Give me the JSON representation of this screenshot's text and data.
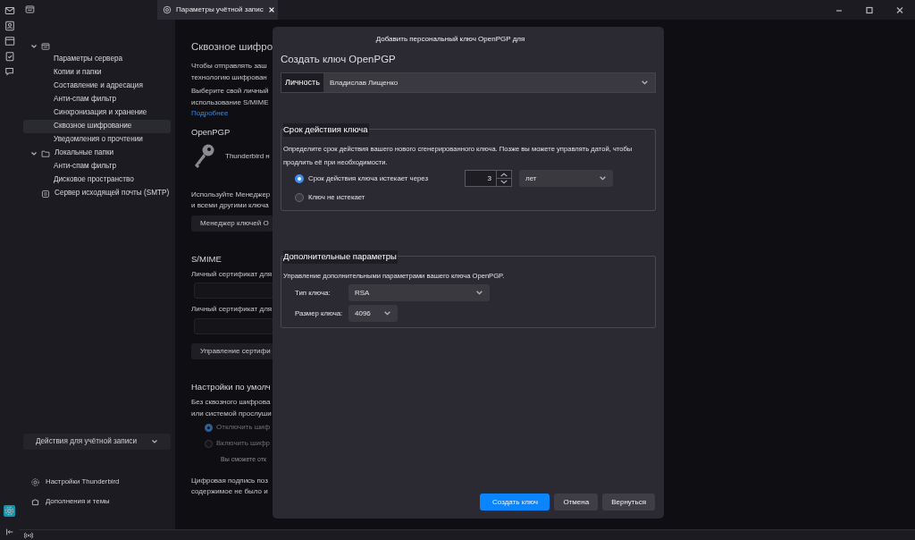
{
  "window": {
    "tab_title": "Параметры учётной запис"
  },
  "spaces": [
    {
      "kind": "mail",
      "selected": false
    },
    {
      "kind": "contacts",
      "selected": false
    },
    {
      "kind": "calendar",
      "selected": false
    },
    {
      "kind": "tasks",
      "selected": false
    },
    {
      "kind": "chat",
      "selected": false
    }
  ],
  "sidebar": {
    "tree": [
      {
        "kind": "account",
        "expanded": true,
        "selected": false,
        "children": [
          {
            "label": "Параметры сервера",
            "selected": false
          },
          {
            "label": "Копии и папки",
            "selected": false
          },
          {
            "label": "Составление и адресация",
            "selected": false
          },
          {
            "label": "Анти-спам фильтр",
            "selected": false
          },
          {
            "label": "Синхронизация и хранение",
            "selected": false
          },
          {
            "label": "Сквозное шифрование",
            "selected": true
          },
          {
            "label": "Уведомления о прочтении",
            "selected": false
          }
        ]
      },
      {
        "kind": "folder",
        "label": "Локальные папки",
        "expanded": true,
        "selected": false,
        "children": [
          {
            "label": "Анти-спам фильтр",
            "selected": false
          },
          {
            "label": "Дисковое пространство",
            "selected": false
          }
        ]
      },
      {
        "kind": "server",
        "label": "Сервер исходящей почты (SMTP)",
        "selected": false
      }
    ],
    "actions_button": "Действия для учётной записи",
    "links": [
      {
        "kind": "settings",
        "label": "Настройки Thunderbird"
      },
      {
        "kind": "addons",
        "label": "Дополнения и темы"
      }
    ]
  },
  "content": [
    {
      "kind": "heading",
      "text": "Сквозное шифро"
    },
    {
      "kind": "text",
      "text": "Чтобы отправлять заш"
    },
    {
      "kind": "text",
      "text": "технологию шифрован"
    },
    {
      "kind": "gap"
    },
    {
      "kind": "text",
      "text": "Выберите свой личный"
    },
    {
      "kind": "text",
      "text": "использование S/MIME"
    },
    {
      "kind": "link",
      "text": "Подробнее"
    },
    {
      "kind": "subheading",
      "text": "OpenPGP"
    },
    {
      "kind": "keyline",
      "text": "Thunderbird н"
    },
    {
      "kind": "text",
      "text": "Используйте Менеджер"
    },
    {
      "kind": "text",
      "text": "и всеми другими ключа"
    },
    {
      "kind": "button",
      "text": "Менеджер ключей О"
    },
    {
      "kind": "subheading",
      "text": "S/MIME"
    },
    {
      "kind": "text",
      "text": "Личный сертификат для"
    },
    {
      "kind": "field"
    },
    {
      "kind": "text",
      "text": "Личный сертификат для"
    },
    {
      "kind": "field"
    },
    {
      "kind": "button",
      "text": "Управление сертифи"
    },
    {
      "kind": "subheading",
      "text": "Настройки по умолч"
    },
    {
      "kind": "text",
      "text": "Без сквозного шифрова"
    },
    {
      "kind": "text",
      "text": "или системой прослуши"
    },
    {
      "kind": "radio",
      "text": "Отключить шиф",
      "selected": true
    },
    {
      "kind": "radio",
      "text": "Включить шифр",
      "selected": false
    },
    {
      "kind": "note",
      "text": "Вы сможете отк"
    },
    {
      "kind": "text",
      "text": "Цифровая подпись поз"
    },
    {
      "kind": "text",
      "text": "содержимое не было и"
    }
  ],
  "dialog": {
    "title": "Добавить персональный ключ OpenPGP для",
    "heading": "Создать ключ OpenPGP",
    "identity": {
      "label": "Личность",
      "value": "Владислав Лищенко"
    },
    "expiry": {
      "legend": "Срок действия ключа",
      "description": "Определите срок действия вашего нового сгенерированного ключа. Позже вы можете управлять датой, чтобы продлить её при необходимости.",
      "options": [
        {
          "kind": "duration",
          "label": "Срок действия ключа истекает через",
          "selected": true
        },
        {
          "kind": "plain",
          "label": "Ключ не истекает",
          "selected": false
        }
      ],
      "amount": "3",
      "unit": "лет"
    },
    "advanced": {
      "legend": "Дополнительные параметры",
      "description": "Управление дополнительными параметрами вашего ключа OpenPGP.",
      "fields": [
        {
          "label": "Тип ключа:",
          "value": "RSA",
          "kind": "wide"
        },
        {
          "label": "Размер ключа:",
          "value": "4096",
          "kind": "narrow"
        }
      ]
    },
    "buttons": [
      {
        "label": "Создать ключ",
        "kind": "primary"
      },
      {
        "label": "Отмена",
        "kind": "secondary"
      },
      {
        "label": "Вернуться",
        "kind": "secondary"
      }
    ]
  }
}
